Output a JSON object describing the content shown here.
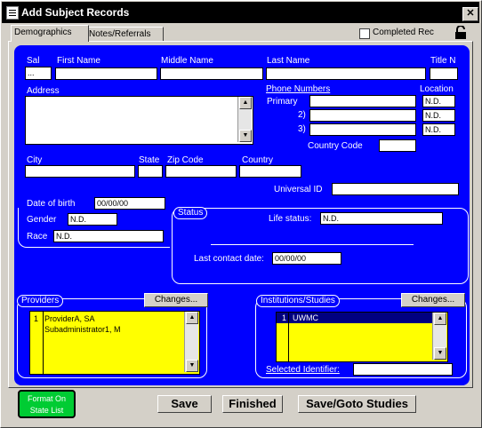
{
  "window": {
    "title": "Add Subject Records",
    "close_glyph": "✕"
  },
  "tabs": [
    {
      "label": "Demographics"
    },
    {
      "label": "Notes/Referrals"
    }
  ],
  "completed_rec_label": "Completed Rec",
  "name": {
    "sal_label": "Sal",
    "sal_value": "...",
    "first_label": "First Name",
    "middle_label": "Middle Name",
    "last_label": "Last Name",
    "title_label": "Title N"
  },
  "address_label": "Address",
  "phone": {
    "header": "Phone Numbers",
    "location_header": "Location",
    "primary_label": "Primary",
    "second_label": "2)",
    "third_label": "3)",
    "loc1": "N.D.",
    "loc2": "N.D.",
    "loc3": "N.D.",
    "country_code_label": "Country Code"
  },
  "place": {
    "city_label": "City",
    "state_label": "State",
    "zip_label": "Zip Code",
    "country_label": "Country"
  },
  "universal_id_label": "Universal ID",
  "dob_label": "Date of birth",
  "dob_value": "00/00/00",
  "gender_label": "Gender",
  "gender_value": "N.D.",
  "race_label": "Race",
  "race_value": "N.D.",
  "status": {
    "title": "Status",
    "life_label": "Life status:",
    "life_value": "N.D.",
    "last_contact_label": "Last contact date:",
    "last_contact_value": "00/00/00"
  },
  "providers": {
    "title": "Providers",
    "changes_label": "Changes...",
    "index": "1",
    "line1": "ProviderA, SA",
    "line2": "Subadministrator1, M"
  },
  "institutions": {
    "title": "Institutions/Studies",
    "changes_label": "Changes...",
    "index": "1",
    "row1": "UWMC",
    "selected_identifier_label": "Selected Identifier:"
  },
  "format_button": {
    "line1": "Format On",
    "line2": "State List"
  },
  "actions": {
    "save": "Save",
    "finished": "Finished",
    "save_goto": "Save/Goto Studies"
  }
}
